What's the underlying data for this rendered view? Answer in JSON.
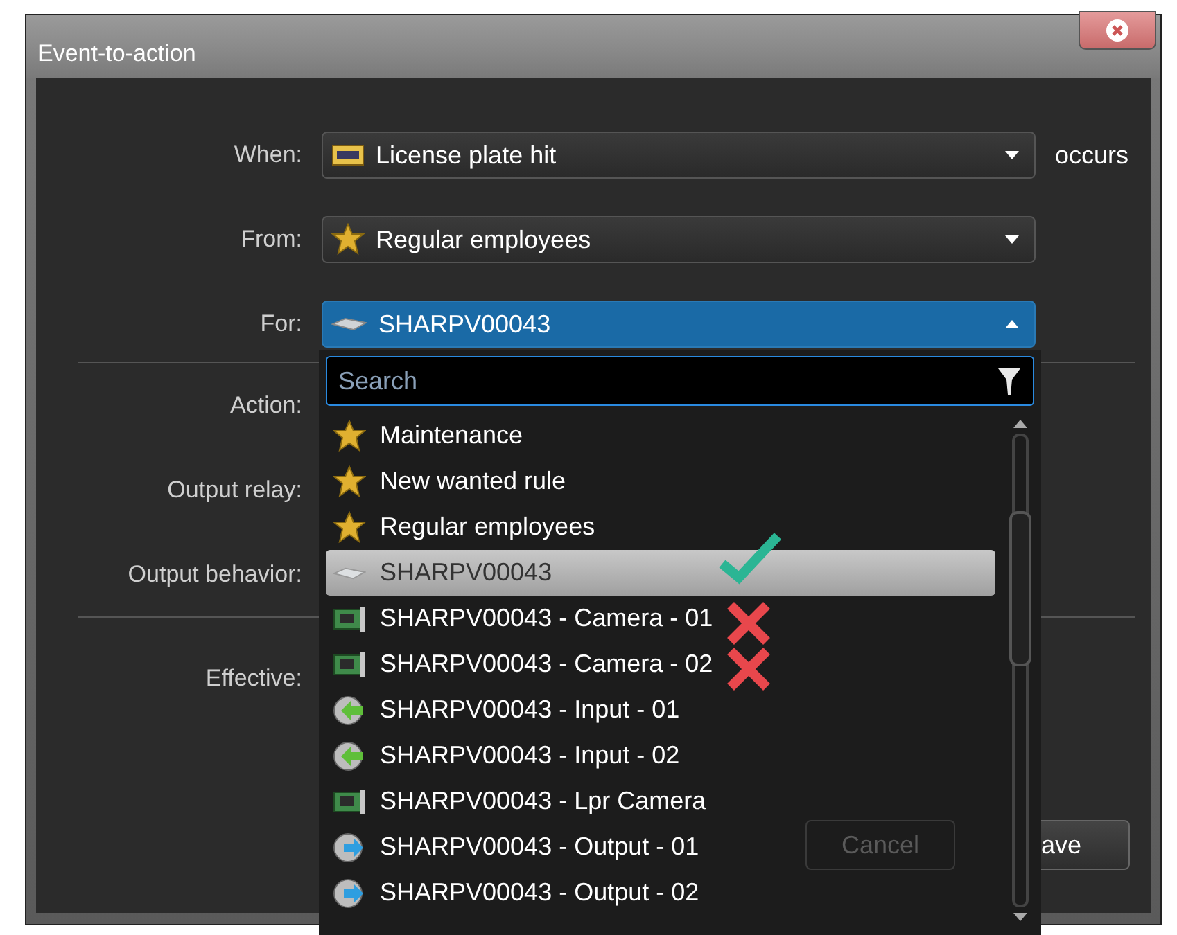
{
  "window": {
    "title": "Event-to-action"
  },
  "fields": [
    {
      "label": "When:",
      "value": "License plate hit",
      "kind": "plate",
      "open": false,
      "suffix": "occurs"
    },
    {
      "label": "From:",
      "value": "Regular employees",
      "kind": "star",
      "open": false
    },
    {
      "label": "For:",
      "value": "SHARPV00043",
      "kind": "unit",
      "open": true
    }
  ],
  "action_labels": [
    "Action:",
    "Output relay:",
    "Output behavior:"
  ],
  "effective_label": "Effective:",
  "buttons": [
    {
      "label": "Cancel",
      "disabled": true
    },
    {
      "label": "ave",
      "disabled": false
    }
  ],
  "dropdown": {
    "search": {
      "placeholder": "Search"
    },
    "items": [
      {
        "label": "Maintenance",
        "kind": "star",
        "selected": false,
        "checked": false,
        "crossed": false
      },
      {
        "label": "New wanted rule",
        "kind": "star",
        "selected": false,
        "checked": false,
        "crossed": false
      },
      {
        "label": "Regular employees",
        "kind": "star",
        "selected": false,
        "checked": false,
        "crossed": false
      },
      {
        "label": "SHARPV00043",
        "kind": "unit",
        "selected": true,
        "checked": true,
        "crossed": false
      },
      {
        "label": "SHARPV00043 - Camera - 01",
        "kind": "camera",
        "selected": false,
        "checked": false,
        "crossed": true
      },
      {
        "label": "SHARPV00043 - Camera - 02",
        "kind": "camera",
        "selected": false,
        "checked": false,
        "crossed": true
      },
      {
        "label": "SHARPV00043 - Input - 01",
        "kind": "input",
        "selected": false,
        "checked": false,
        "crossed": false
      },
      {
        "label": "SHARPV00043 - Input - 02",
        "kind": "input",
        "selected": false,
        "checked": false,
        "crossed": false
      },
      {
        "label": "SHARPV00043 - Lpr Camera",
        "kind": "camera",
        "selected": false,
        "checked": false,
        "crossed": false
      },
      {
        "label": "SHARPV00043 - Output - 01",
        "kind": "output",
        "selected": false,
        "checked": false,
        "crossed": false
      },
      {
        "label": "SHARPV00043 - Output - 02",
        "kind": "output",
        "selected": false,
        "checked": false,
        "crossed": false
      }
    ]
  }
}
